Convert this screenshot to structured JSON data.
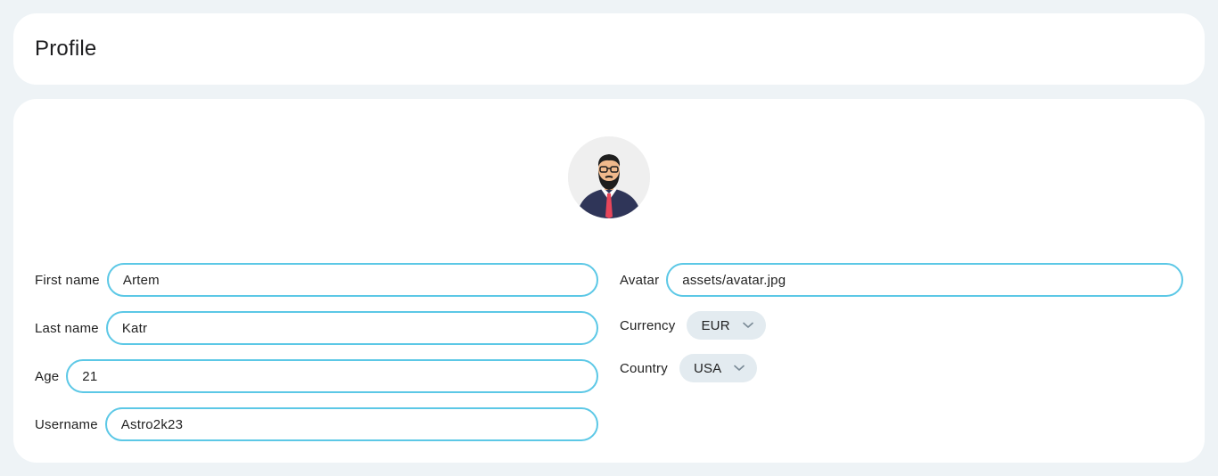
{
  "header": {
    "title": "Profile"
  },
  "avatar": {
    "icon": "user-avatar-icon"
  },
  "fields": {
    "first_name": {
      "label": "First name",
      "value": "Artem"
    },
    "last_name": {
      "label": "Last name",
      "value": "Katr"
    },
    "age": {
      "label": "Age",
      "value": "21"
    },
    "username": {
      "label": "Username",
      "value": "Astro2k23"
    },
    "avatar_path": {
      "label": "Avatar",
      "value": "assets/avatar.jpg"
    },
    "currency": {
      "label": "Currency",
      "value": "EUR"
    },
    "country": {
      "label": "Country",
      "value": "USA"
    }
  },
  "colors": {
    "background": "#eef3f6",
    "card": "#ffffff",
    "input_border": "#5cc8e6",
    "select_bg": "#e3ebf0"
  }
}
